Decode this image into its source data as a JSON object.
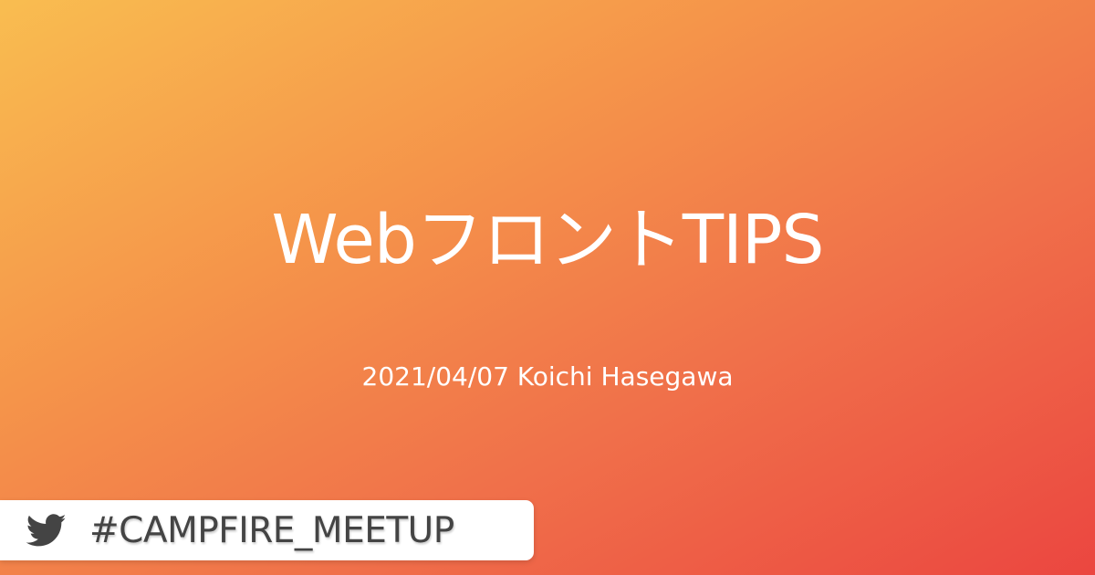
{
  "slide": {
    "title": "WebフロントTIPS",
    "subtitle": "2021/04/07 Koichi Hasegawa",
    "hashtag_badge": {
      "icon": "twitter-bird-icon",
      "text": "#CAMPFIRE_MEETUP"
    }
  },
  "colors": {
    "gradient_start": "#f9bd50",
    "gradient_end": "#eb4640",
    "badge_text": "#444444"
  }
}
